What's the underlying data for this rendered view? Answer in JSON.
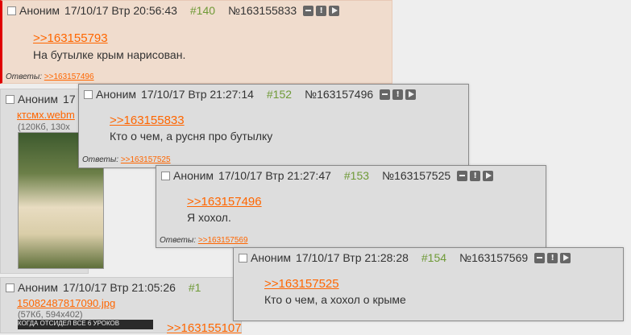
{
  "posts": {
    "p140": {
      "name": "Аноним",
      "date": "17/10/17 Втр 20:56:43",
      "num": "#140",
      "id": "№163155833",
      "reflink": ">>163155793",
      "message": "На бутылке крым нарисован.",
      "replies_label": "Ответы:",
      "reply": ">>163157496"
    },
    "p_webm": {
      "name": "Аноним",
      "date": "17",
      "file_name": "ктсмх.webm",
      "file_info": "(120Кб, 130x"
    },
    "p_jpg": {
      "name": "Аноним",
      "date": "17/10/17 Втр 21:05:26",
      "num": "#1",
      "file_name": "15082487817090.jpg",
      "file_info": "(57Кб, 594x402)",
      "thumb_text": "КОГДА ОТСИДЕЛ ВСЕ 6 УРОКОВ",
      "reflink": ">>163155107"
    },
    "p152": {
      "name": "Аноним",
      "date": "17/10/17 Втр 21:27:14",
      "num": "#152",
      "id": "№163157496",
      "reflink": ">>163155833",
      "message": "Кто о чем, а русня про бутылку",
      "replies_label": "Ответы:",
      "reply": ">>163157525"
    },
    "p153": {
      "name": "Аноним",
      "date": "17/10/17 Втр 21:27:47",
      "num": "#153",
      "id": "№163157525",
      "reflink": ">>163157496",
      "message": "Я хохол.",
      "replies_label": "Ответы:",
      "reply": ">>163157569"
    },
    "p154": {
      "name": "Аноним",
      "date": "17/10/17 Втр 21:28:28",
      "num": "#154",
      "id": "№163157569",
      "reflink": ">>163157525",
      "message": "Кто о чем, а хохол о крыме"
    }
  },
  "icons": [
    "minus-icon",
    "exclamation-icon",
    "play-icon"
  ],
  "colors": {
    "link": "#ff6600",
    "post_number": "#6f9a37",
    "highlight": "#f0dccd",
    "marker": "#e00000"
  }
}
